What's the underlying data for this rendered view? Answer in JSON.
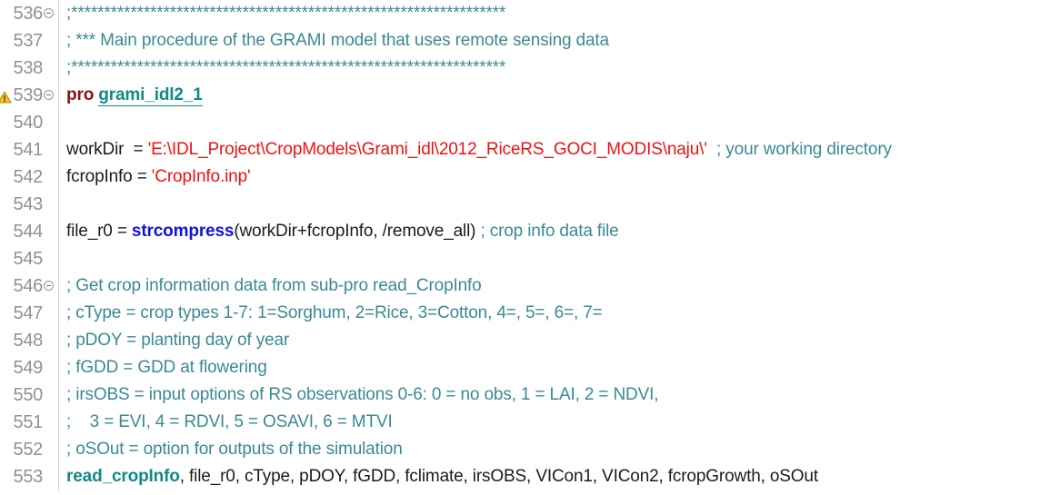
{
  "editor": {
    "language": "IDL",
    "gutter_fold_icon": "fold-collapse-icon",
    "warning_icon": "warning-triangle-icon",
    "colors": {
      "background": "#ffffff",
      "line_number": "#8e9295",
      "comment": "#3a8a93",
      "string": "#f50f0f",
      "keyword": "#8c1111",
      "builtin_function": "#1313d8",
      "procedure_name": "#0f8a86",
      "plain_code": "#1b1b1b",
      "warning_squiggle": "#f2c200",
      "gutter_separator": "#d6d6d6"
    }
  },
  "lines": [
    {
      "number": "536",
      "fold": true,
      "warning": false,
      "tokens": [
        {
          "type": "comment",
          "text": ";******************************************************************"
        }
      ]
    },
    {
      "number": "537",
      "fold": false,
      "warning": false,
      "tokens": [
        {
          "type": "comment",
          "text": "; *** Main procedure of the GRAMI model that uses remote sensing data"
        }
      ]
    },
    {
      "number": "538",
      "fold": false,
      "warning": false,
      "tokens": [
        {
          "type": "comment",
          "text": ";******************************************************************"
        }
      ]
    },
    {
      "number": "539",
      "fold": true,
      "warning": true,
      "tokens": [
        {
          "type": "keyword",
          "text": "pro"
        },
        {
          "type": "plain",
          "text": " "
        },
        {
          "type": "decl",
          "text": "grami_idl2_1"
        }
      ]
    },
    {
      "number": "540",
      "fold": false,
      "warning": false,
      "tokens": []
    },
    {
      "number": "541",
      "fold": false,
      "warning": false,
      "tokens": [
        {
          "type": "plain",
          "text": "workDir  = "
        },
        {
          "type": "string",
          "text": "'E:\\IDL_Project\\CropModels\\Grami_idl\\2012_RiceRS_GOCI_MODIS\\naju\\'"
        },
        {
          "type": "plain",
          "text": "  "
        },
        {
          "type": "comment",
          "text": "; your working directory"
        }
      ]
    },
    {
      "number": "542",
      "fold": false,
      "warning": false,
      "tokens": [
        {
          "type": "plain",
          "text": "fcropInfo = "
        },
        {
          "type": "string",
          "text": "'CropInfo.inp'"
        }
      ]
    },
    {
      "number": "543",
      "fold": false,
      "warning": false,
      "tokens": []
    },
    {
      "number": "544",
      "fold": false,
      "warning": false,
      "tokens": [
        {
          "type": "plain",
          "text": "file_r0 = "
        },
        {
          "type": "builtin",
          "text": "strcompress"
        },
        {
          "type": "plain",
          "text": "(workDir+fcropInfo, /remove_all) "
        },
        {
          "type": "comment",
          "text": "; crop info data file"
        }
      ]
    },
    {
      "number": "545",
      "fold": false,
      "warning": false,
      "tokens": []
    },
    {
      "number": "546",
      "fold": true,
      "warning": false,
      "tokens": [
        {
          "type": "comment",
          "text": "; Get crop information data from sub-pro read_CropInfo"
        }
      ]
    },
    {
      "number": "547",
      "fold": false,
      "warning": false,
      "tokens": [
        {
          "type": "comment",
          "text": "; cType = crop types 1-7: 1=Sorghum, 2=Rice, 3=Cotton, 4=, 5=, 6=, 7="
        }
      ]
    },
    {
      "number": "548",
      "fold": false,
      "warning": false,
      "tokens": [
        {
          "type": "comment",
          "text": "; pDOY = planting day of year"
        }
      ]
    },
    {
      "number": "549",
      "fold": false,
      "warning": false,
      "tokens": [
        {
          "type": "comment",
          "text": "; fGDD = GDD at flowering"
        }
      ]
    },
    {
      "number": "550",
      "fold": false,
      "warning": false,
      "tokens": [
        {
          "type": "comment",
          "text": "; irsOBS = input options of RS observations 0-6: 0 = no obs, 1 = LAI, 2 = NDVI,"
        }
      ]
    },
    {
      "number": "551",
      "fold": false,
      "warning": false,
      "tokens": [
        {
          "type": "comment",
          "text": ";    3 = EVI, 4 = RDVI, 5 = OSAVI, 6 = MTVI"
        }
      ]
    },
    {
      "number": "552",
      "fold": false,
      "warning": false,
      "tokens": [
        {
          "type": "comment",
          "text": "; oSOut = option for outputs of the simulation"
        }
      ]
    },
    {
      "number": "553",
      "fold": false,
      "warning": false,
      "tokens": [
        {
          "type": "proc",
          "text": "read_cropInfo"
        },
        {
          "type": "plain",
          "text": ", file_r0, cType, pDOY, fGDD, fclimate, irsOBS, VICon1, VICon2, fcropGrowth, oSOut"
        }
      ]
    }
  ]
}
